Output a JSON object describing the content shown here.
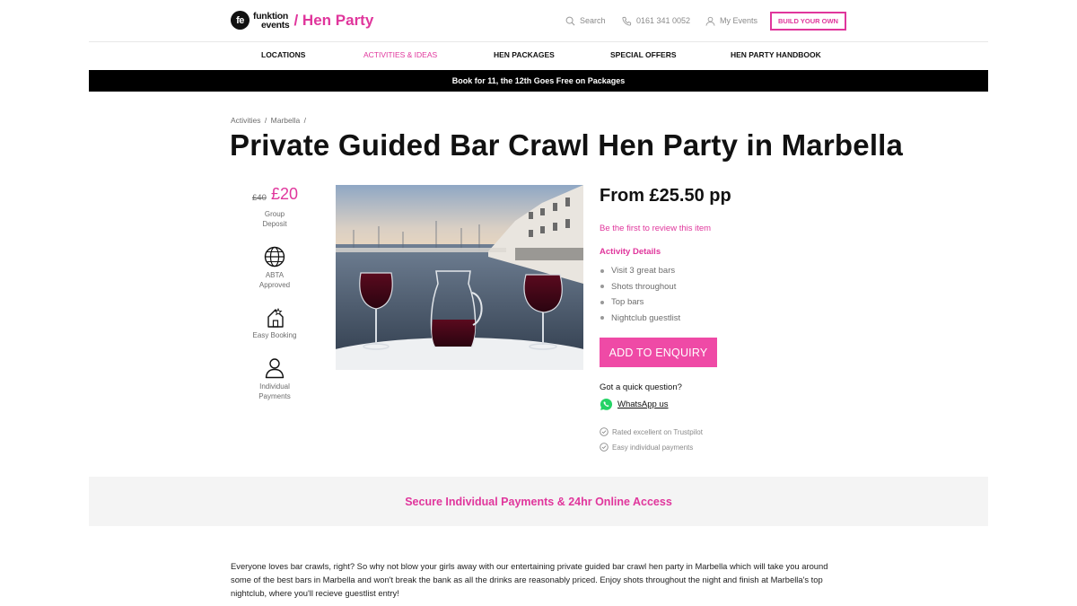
{
  "header": {
    "logo_badge": "fe",
    "logo_line1": "funktion",
    "logo_line2": "events",
    "brand_suffix": "/ Hen Party",
    "search_label": "Search",
    "phone_label": "0161 341 0052",
    "my_events_label": "My Events",
    "build_button": "BUILD YOUR OWN"
  },
  "nav": {
    "items": [
      {
        "label": "LOCATIONS",
        "active": false
      },
      {
        "label": "ACTIVITIES & IDEAS",
        "active": true
      },
      {
        "label": "HEN PACKAGES",
        "active": false
      },
      {
        "label": "SPECIAL OFFERS",
        "active": false
      },
      {
        "label": "HEN PARTY HANDBOOK",
        "active": false
      }
    ]
  },
  "promo_banner": "Book for 11, the 12th Goes Free on Packages",
  "breadcrumb": [
    "Activities",
    "/",
    "Marbella",
    "/"
  ],
  "title": "Private Guided Bar Crawl Hen Party in Marbella",
  "deposit": {
    "old_price": "£40",
    "new_price": "£20",
    "label_line1": "Group",
    "label_line2": "Deposit"
  },
  "features": [
    {
      "icon": "globe-icon",
      "line1": "ABTA",
      "line2": "Approved"
    },
    {
      "icon": "house-star-icon",
      "line1": "Easy Booking",
      "line2": ""
    },
    {
      "icon": "person-icon",
      "line1": "Individual",
      "line2": "Payments"
    }
  ],
  "product": {
    "from_price": "From £25.50 pp",
    "review_link": "Be the first to review this item",
    "details_heading": "Activity Details",
    "details": [
      "Visit 3 great bars",
      "Shots throughout",
      "Top bars",
      "Nightclub guestlist"
    ],
    "enquiry_button": "ADD TO ENQUIRY",
    "quick_question": "Got a quick question?",
    "whatsapp_label": "WhatsApp us",
    "trust_points": [
      "Rated excellent on Trustpilot",
      "Easy individual payments"
    ]
  },
  "secure_band": "Secure Individual Payments & 24hr Online Access",
  "description": "Everyone loves bar crawls, right? So why not blow your girls away with our entertaining private guided bar crawl hen party in Marbella which will take you around some of the best bars in Marbella and won't break the bank as all the drinks are reasonably priced. Enjoy shots throughout the night and finish at Marbella's top nightclub, where you'll recieve guestlist entry!",
  "colors": {
    "accent": "#e0369c",
    "button": "#ef4aa6",
    "promo_bg": "#000000",
    "band_bg": "#f4f4f4"
  }
}
